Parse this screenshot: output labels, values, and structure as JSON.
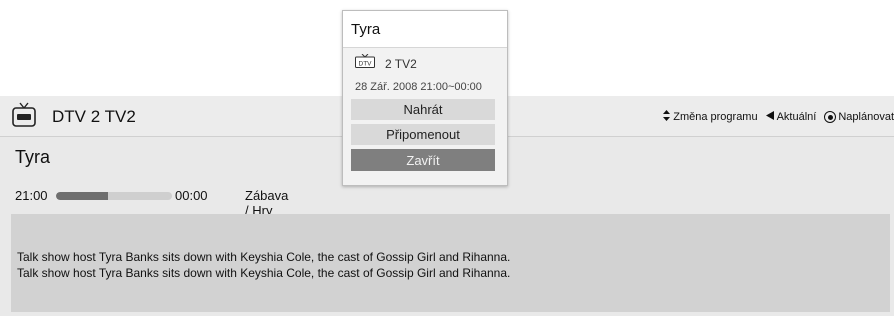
{
  "channel": {
    "name": "DTV 2  TV2",
    "icon": "tv-icon"
  },
  "hints": [
    {
      "icon": "up-down-arrows-icon",
      "label": "Změna programu"
    },
    {
      "icon": "left-arrow-icon",
      "label": "Aktuální"
    },
    {
      "icon": "ok-button-icon",
      "label": "Naplánovat"
    }
  ],
  "program": {
    "title": "Tyra",
    "start": "21:00",
    "end": "00:00",
    "progress": 0.45,
    "genre": "Zábava / Hry",
    "description": [
      "Talk show host Tyra Banks sits down with Keyshia Cole, the cast of Gossip Girl and Rihanna.",
      "Talk show host Tyra Banks sits down with Keyshia Cole, the cast of Gossip Girl and Rihanna."
    ]
  },
  "popup": {
    "title": "Tyra",
    "badge": "DTV",
    "channel": "2 TV2",
    "time": "28 Zář. 2008 21:00~00:00",
    "buttons": {
      "record": "Nahrát",
      "remind": "Připomenout",
      "close": "Zavřít"
    }
  },
  "colors": {
    "panel": "#e9e9e9",
    "description_box": "#d2d2d2",
    "progress_fill": "#6e6e6e",
    "close_button": "#7f7f7f"
  }
}
